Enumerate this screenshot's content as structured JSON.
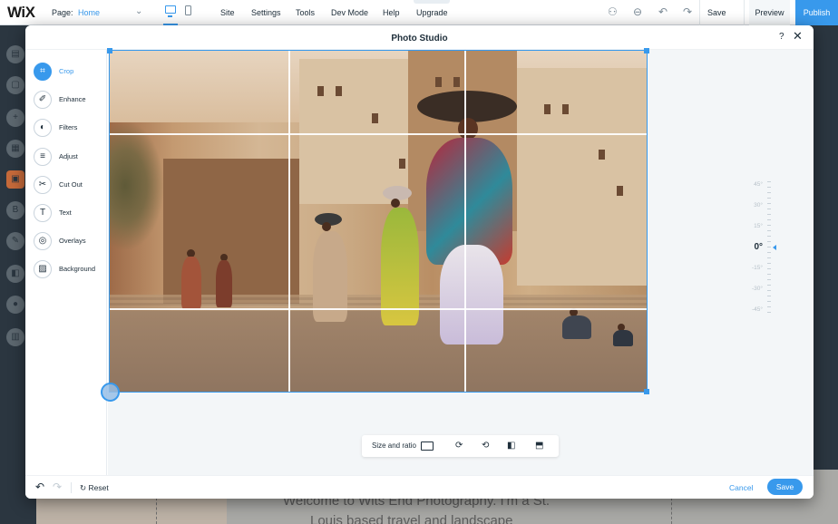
{
  "editor_bar": {
    "logo": "WiX",
    "page_label": "Page:",
    "page_value": "Home",
    "menu": [
      "Site",
      "Settings",
      "Tools",
      "Dev Mode",
      "Help",
      "Upgrade"
    ],
    "save_label": "Save",
    "preview_label": "Preview",
    "publish_label": "Publish",
    "icons": [
      "desktop-icon",
      "mobile-icon",
      "accessibility-icon",
      "zoom-out-icon",
      "undo-icon",
      "redo-icon"
    ]
  },
  "background_page": {
    "welcome_line1": "Welcome to Wits End Photography. I'm a St.",
    "welcome_line2": "Louis based travel and landscape"
  },
  "modal": {
    "title": "Photo Studio",
    "help_label": "?",
    "close_label": "✕"
  },
  "sidebar": {
    "items": [
      {
        "label": "Crop",
        "icon": "crop-icon",
        "active": true
      },
      {
        "label": "Enhance",
        "icon": "enhance-icon",
        "active": false
      },
      {
        "label": "Filters",
        "icon": "filters-icon",
        "active": false
      },
      {
        "label": "Adjust",
        "icon": "adjust-icon",
        "active": false
      },
      {
        "label": "Cut Out",
        "icon": "scissors-icon",
        "active": false
      },
      {
        "label": "Text",
        "icon": "text-icon",
        "active": false
      },
      {
        "label": "Overlays",
        "icon": "overlays-icon",
        "active": false
      },
      {
        "label": "Background",
        "icon": "background-icon",
        "active": false
      }
    ]
  },
  "straighten": {
    "labels": [
      "45°",
      "30°",
      "15°",
      "0°",
      "-15°",
      "-30°",
      "-45°"
    ],
    "current": "0°"
  },
  "crop_toolbar": {
    "size_label": "Size and ratio",
    "icons": [
      "aspect-ratio-icon",
      "rotate-right-icon",
      "rotate-left-icon",
      "flip-horizontal-icon",
      "flip-vertical-icon"
    ]
  },
  "footer": {
    "reset_label": "Reset",
    "cancel_label": "Cancel",
    "save_label": "Save"
  },
  "colors": {
    "accent": "#3899ec",
    "text": "#20303c",
    "stage": "#f3f6f8"
  }
}
